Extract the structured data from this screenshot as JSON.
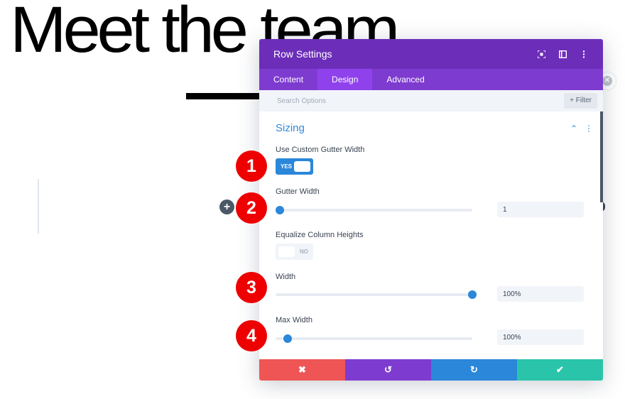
{
  "page": {
    "headline": "Meet the team",
    "add_row_icon": "plus-icon",
    "close_icon": "close-icon"
  },
  "modal": {
    "title": "Row Settings",
    "header_icons": [
      "fullscreen-icon",
      "split-view-icon",
      "more-vertical-icon"
    ],
    "tabs": [
      {
        "label": "Content",
        "active": false
      },
      {
        "label": "Design",
        "active": true
      },
      {
        "label": "Advanced",
        "active": false
      }
    ],
    "search": {
      "placeholder": "Search Options",
      "value": ""
    },
    "filter_label": "+ Filter",
    "section": {
      "title": "Sizing",
      "collapse_icon": "chevron-up-icon",
      "options_icon": "more-vertical-icon"
    },
    "fields": {
      "custom_gutter": {
        "label": "Use Custom Gutter Width",
        "toggle_text": "YES",
        "enabled": true
      },
      "gutter_width": {
        "label": "Gutter Width",
        "value": "1",
        "slider_fraction": 0.02
      },
      "equalize": {
        "label": "Equalize Column Heights",
        "toggle_text": "NO",
        "enabled": false
      },
      "width": {
        "label": "Width",
        "value": "100%",
        "slider_fraction": 1.0
      },
      "max_width": {
        "label": "Max Width",
        "value": "100%",
        "slider_fraction": 0.06
      }
    },
    "footer": [
      {
        "name": "cancel",
        "icon": "✖",
        "color": "#ef5555"
      },
      {
        "name": "undo",
        "icon": "↺",
        "color": "#7e3bd0"
      },
      {
        "name": "redo",
        "icon": "↻",
        "color": "#2b87da"
      },
      {
        "name": "save",
        "icon": "✔",
        "color": "#29c4a9"
      }
    ]
  },
  "annotations": [
    "1",
    "2",
    "3",
    "4"
  ],
  "colors": {
    "header": "#6c2eb9",
    "tabs": "#7e3bd0",
    "active_tab": "#8f42ec",
    "accent": "#2b87da",
    "badge": "#ee0000"
  }
}
